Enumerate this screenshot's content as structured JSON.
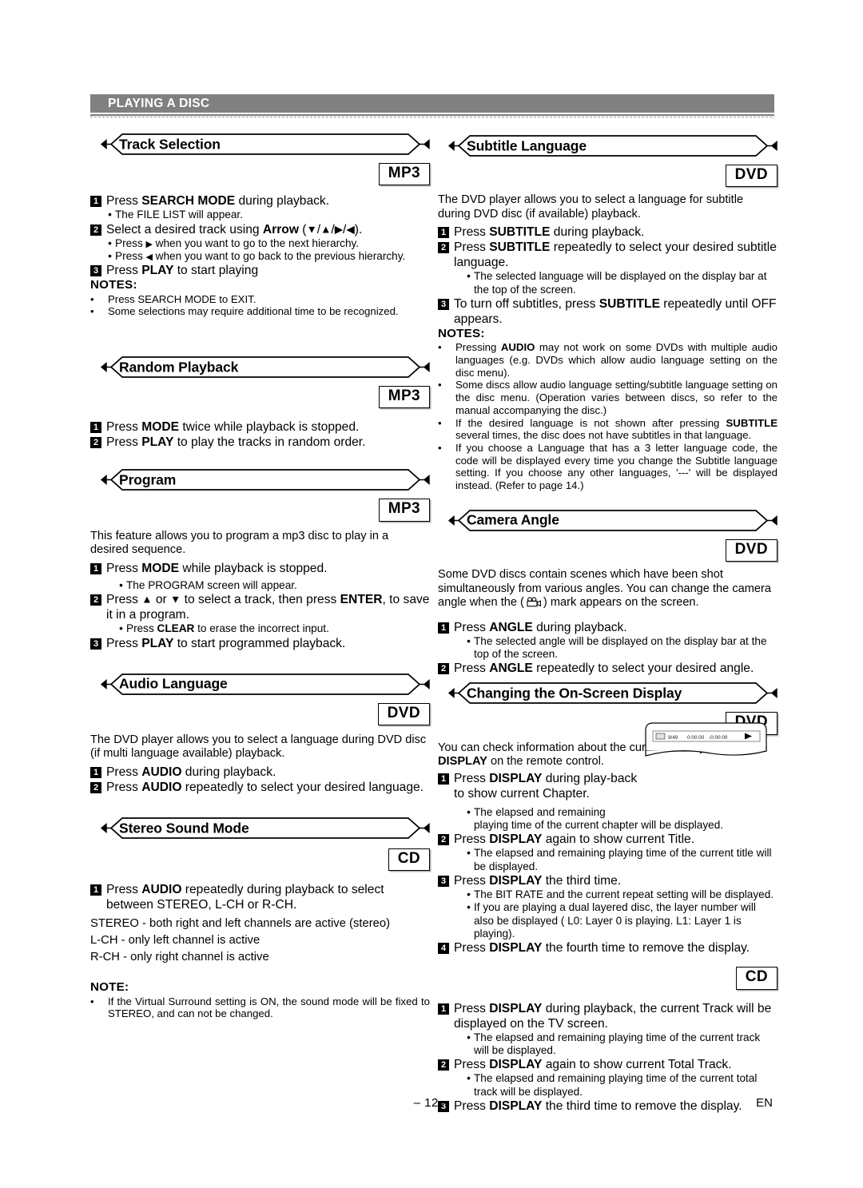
{
  "chapter": {
    "title": "PLAYING A DISC"
  },
  "footer": {
    "page": "– 12 –",
    "language_code": "EN"
  },
  "left": {
    "track_selection": {
      "heading": "Track Selection",
      "badge": "MP3",
      "steps": [
        {
          "num": "1",
          "text_parts": [
            "Press ",
            "SEARCH MODE",
            " during playback."
          ]
        },
        {
          "num": "2",
          "text_parts": [
            "Select a desired track using ",
            "Arrow",
            " (▼/▲/▶/◀)."
          ]
        },
        {
          "num": "3",
          "text_parts": [
            "Press ",
            "PLAY",
            " to start playing"
          ]
        }
      ],
      "step1_bullet": "The FILE LIST will appear.",
      "step2_bullets": [
        "Press ▶ when you want to go to the next hierarchy.",
        "Press ◀ when you want to go back to the previous hierarchy."
      ],
      "notes_title": "NOTES:",
      "notes": [
        "Press SEARCH MODE to EXIT.",
        "Some selections may require additional time to be recognized."
      ]
    },
    "random_playback": {
      "heading": "Random Playback",
      "badge": "MP3",
      "steps": [
        {
          "num": "1",
          "text_parts": [
            "Press ",
            "MODE",
            " twice while playback is stopped."
          ]
        },
        {
          "num": "2",
          "text_parts": [
            "Press ",
            "PLAY",
            " to play the tracks in random order."
          ]
        }
      ]
    },
    "program": {
      "heading": "Program",
      "badge": "MP3",
      "intro": "This feature allows you to program a mp3 disc to play in a desired sequence.",
      "steps": [
        {
          "num": "1",
          "text_parts": [
            "Press ",
            "MODE",
            " while playback is stopped."
          ]
        },
        {
          "num": "2",
          "text_parts": [
            "Press ▲ or ▼ to select a track, then press ",
            "ENTER",
            ", to save it in a program."
          ]
        },
        {
          "num": "3",
          "text_parts": [
            "Press ",
            "PLAY",
            " to start programmed playback."
          ]
        }
      ],
      "step1_bullet": "The PROGRAM screen will appear.",
      "step2_bullet_parts": [
        "Press ",
        "CLEAR",
        " to erase the incorrect input."
      ]
    },
    "audio_language": {
      "heading": "Audio Language",
      "badge": "DVD",
      "intro": "The DVD player allows you to select a language during DVD disc (if multi language available) playback.",
      "steps": [
        {
          "num": "1",
          "text_parts": [
            "Press ",
            "AUDIO",
            " during playback."
          ]
        },
        {
          "num": "2",
          "text_parts": [
            "Press ",
            "AUDIO",
            " repeatedly to select your desired language."
          ]
        }
      ]
    },
    "stereo_sound_mode": {
      "heading": "Stereo Sound Mode",
      "badge": "CD",
      "steps": [
        {
          "num": "1",
          "text_parts": [
            "Press ",
            "AUDIO",
            " repeatedly during playback to select between STEREO, L-CH or R-CH."
          ]
        }
      ],
      "mode_lines": [
        "STEREO - both right and left channels are active (stereo)",
        "L-CH - only left channel is active",
        "R-CH - only right channel is active"
      ],
      "note_title": "NOTE:",
      "notes": [
        "If the Virtual Surround setting is ON, the sound mode will be fixed to STEREO, and can not be changed."
      ]
    }
  },
  "right": {
    "subtitle_language": {
      "heading": "Subtitle Language",
      "badge": "DVD",
      "intro": "The DVD player allows you to select a language for subtitle during DVD disc (if available) playback.",
      "steps": [
        {
          "num": "1",
          "text_parts": [
            "Press ",
            "SUBTITLE",
            " during playback."
          ]
        },
        {
          "num": "2",
          "text_parts": [
            "Press ",
            "SUBTITLE",
            " repeatedly to select your desired subtitle language."
          ]
        },
        {
          "num": "3",
          "text_parts": [
            "To turn off subtitles, press ",
            "SUBTITLE",
            " repeatedly until OFF appears."
          ]
        }
      ],
      "step2_bullet": "The selected language will be displayed on the display bar at the top of the screen.",
      "notes_title": "NOTES:",
      "notes": [
        {
          "parts": [
            "Pressing ",
            "AUDIO",
            " may not work on some DVDs with multiple audio languages (e.g. DVDs which allow audio language setting on the disc menu)."
          ]
        },
        {
          "parts": [
            "Some discs allow audio language setting/subtitle language setting on the disc menu. (Operation varies between discs, so refer to the manual accompanying the disc.)"
          ]
        },
        {
          "parts": [
            "If the desired language is not shown after pressing ",
            "SUBTITLE",
            " several times, the disc does not have subtitles in that language."
          ]
        },
        {
          "parts": [
            "If you choose a Language that has a 3 letter language code, the code will be displayed every time you change the Subtitle language setting. If you choose any other languages, '---' will be displayed instead. (Refer to page 14.)"
          ]
        }
      ]
    },
    "camera_angle": {
      "heading": "Camera Angle",
      "badge": "DVD",
      "intro_a": "Some DVD discs contain scenes which have been shot simultaneously from various angles. You can change the camera angle when the (",
      "intro_b": ") mark appears on the screen.",
      "steps": [
        {
          "num": "1",
          "text_parts": [
            "Press ",
            "ANGLE",
            " during playback."
          ]
        },
        {
          "num": "2",
          "text_parts": [
            "Press ",
            "ANGLE",
            " repeatedly to select your desired angle."
          ]
        }
      ],
      "step1_bullet": "The selected angle will be displayed on the display bar at the top of the screen."
    },
    "on_screen_display": {
      "heading": "Changing the On-Screen Display",
      "badge_dvd": "DVD",
      "badge_cd": "CD",
      "intro_parts": [
        "You can check information about the current disc by pressing ",
        "DISPLAY",
        " on the remote control."
      ],
      "tv_display": {
        "chapter_counter": "9/49",
        "elapsed": "0:00:00",
        "remaining": "-0:00:00",
        "play_icon": "▶"
      },
      "dvd_steps": [
        {
          "num": "1",
          "text_parts": [
            "Press ",
            "DISPLAY",
            " during play-back to show current Chapter."
          ]
        },
        {
          "num": "2",
          "text_parts": [
            "Press ",
            "DISPLAY",
            " again to show current Title."
          ]
        },
        {
          "num": "3",
          "text_parts": [
            "Press ",
            "DISPLAY",
            " the third time."
          ]
        },
        {
          "num": "4",
          "text_parts": [
            "Press ",
            "DISPLAY",
            " the fourth time to remove the display."
          ]
        }
      ],
      "dvd_step1_bullets": [
        "The elapsed and remaining",
        "playing time of the current chapter will be displayed."
      ],
      "dvd_step2_bullet": "The elapsed and remaining playing time of the current title will be displayed.",
      "dvd_step3_bullets": [
        "The BIT RATE and the current repeat setting will be displayed.",
        "If you are playing a dual layered disc, the layer number will also be displayed ( L0: Layer 0 is playing.  L1: Layer 1 is playing)."
      ],
      "cd_steps": [
        {
          "num": "1",
          "text_parts": [
            "Press ",
            "DISPLAY",
            " during playback, the current Track will be displayed on the TV screen."
          ]
        },
        {
          "num": "2",
          "text_parts": [
            "Press ",
            "DISPLAY",
            " again to show current Total Track."
          ]
        },
        {
          "num": "3",
          "text_parts": [
            "Press ",
            "DISPLAY",
            " the third time to remove the display."
          ]
        }
      ],
      "cd_step1_bullet": "The elapsed and remaining playing time of the current track will be displayed.",
      "cd_step2_bullet": "The elapsed and remaining playing time of the current total track will be displayed."
    }
  },
  "colors": {
    "banner_gray": "#808080",
    "text": "#000000",
    "page_bg": "#ffffff"
  }
}
